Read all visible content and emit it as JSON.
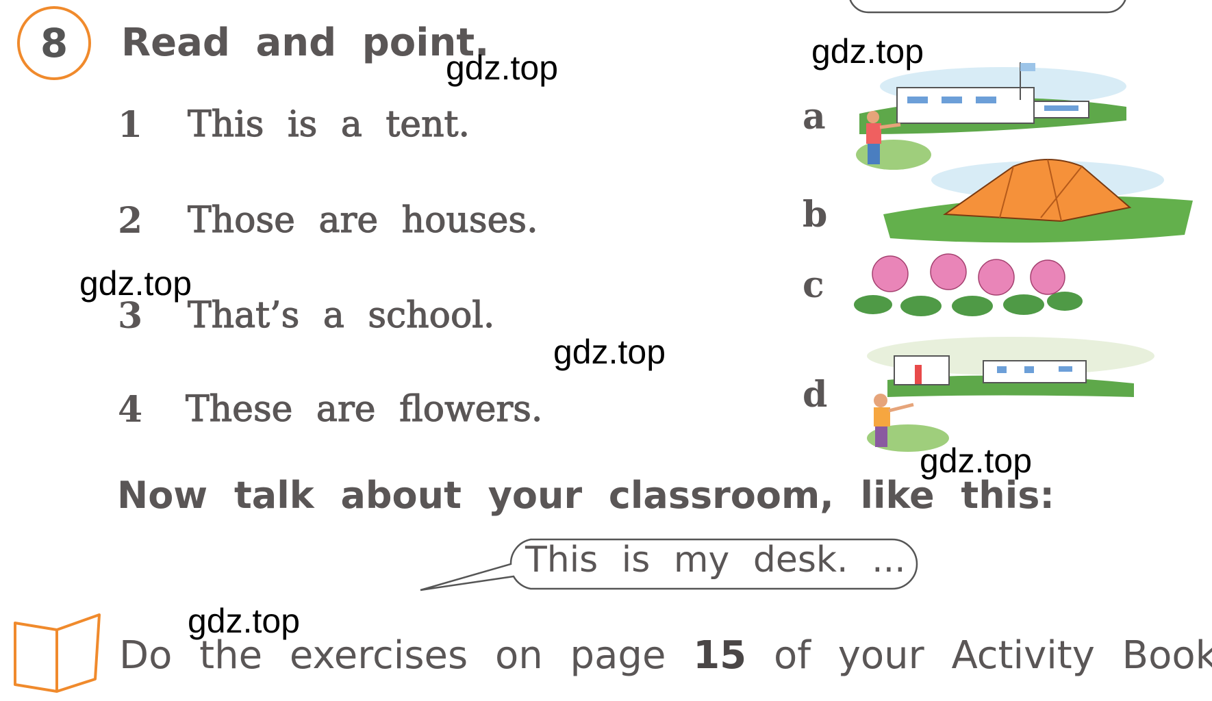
{
  "exercise": {
    "number": "8",
    "title": "Read and point.",
    "sentences": [
      {
        "num": "1",
        "text": "This is a tent."
      },
      {
        "num": "2",
        "text": "Those are houses."
      },
      {
        "num": "3",
        "text": "That’s a school."
      },
      {
        "num": "4",
        "text": "These are flowers."
      }
    ],
    "pictures": [
      {
        "letter": "a",
        "subject": "school building with boy pointing"
      },
      {
        "letter": "b",
        "subject": "orange tent"
      },
      {
        "letter": "c",
        "subject": "pink flowers"
      },
      {
        "letter": "d",
        "subject": "houses with boy pointing"
      }
    ],
    "talk_prompt": "Now talk about your classroom, like this:",
    "speech_bubble": "This is my desk. ...",
    "homework": {
      "before": "Do the exercises on page",
      "page": "15",
      "after": "of your Activity Book.",
      "icon": "open-book-icon"
    }
  },
  "watermarks": [
    "gdz.top",
    "gdz.top",
    "gdz.top",
    "gdz.top",
    "gdz.top",
    "gdz.top"
  ],
  "colors": {
    "accent": "#f08a2c",
    "text": "#5a5656"
  }
}
